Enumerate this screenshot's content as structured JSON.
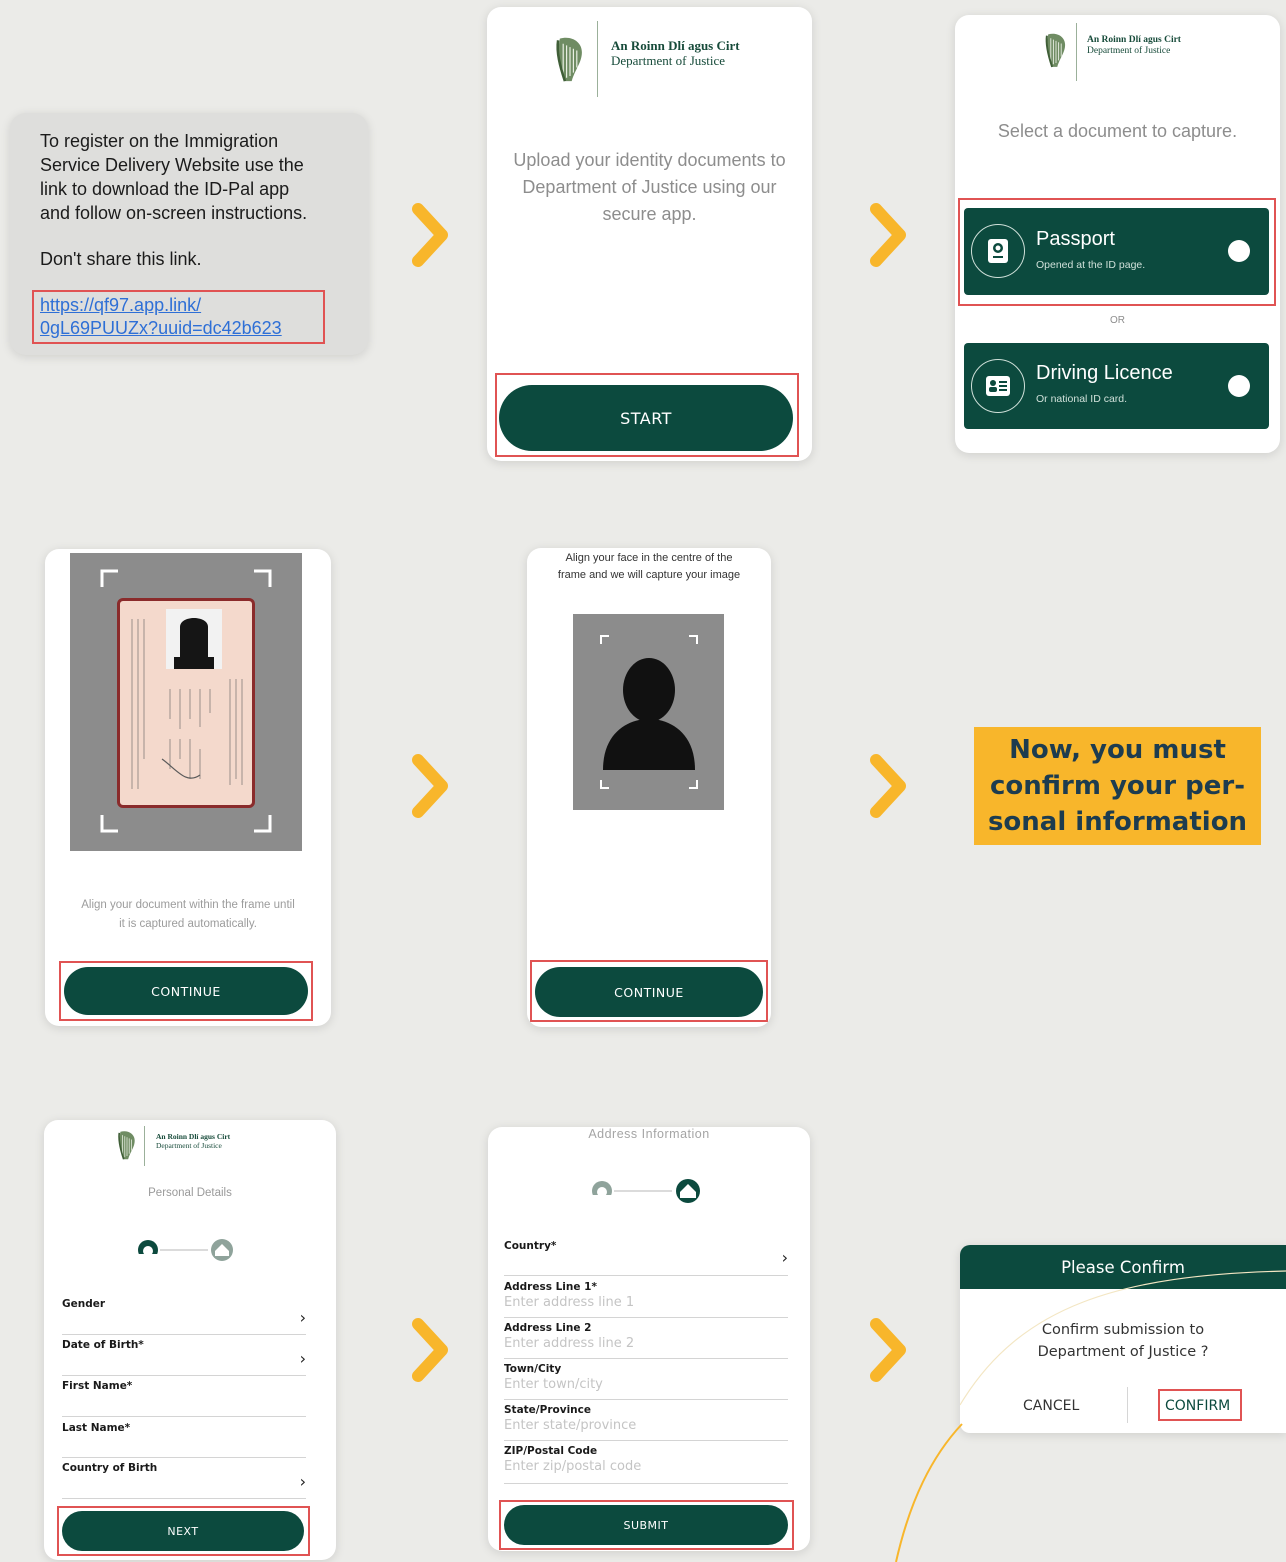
{
  "colors": {
    "background": "#ebebe8",
    "brand_green": "#0c4a3e",
    "accent_yellow": "#f8b62b",
    "highlight_red": "#e05353",
    "banner_text": "#1d3c4f"
  },
  "sms": {
    "message_lines": [
      "To register on the Immigration",
      "Service Delivery Website use the",
      "link to download the ID-Pal app",
      "and follow on-screen instructions."
    ],
    "warning": "Don't share this link.",
    "link_line1": "https://qf97.app.link/",
    "link_line2": "0gL69PUUZx?uuid=dc42b623"
  },
  "logo": {
    "irish": "An Roinn Dlí agus Cirt",
    "english": "Department of Justice"
  },
  "start_screen": {
    "message_lines": [
      "Upload your identity documents to",
      "Department of Justice  using our",
      "secure app."
    ],
    "start_label": "START"
  },
  "select_screen": {
    "title": "Select a document to capture.",
    "passport_title": "Passport",
    "passport_sub": "Opened at the ID page.",
    "or_label": "OR",
    "licence_title": "Driving Licence",
    "licence_sub": "Or national ID card."
  },
  "doc_capture": {
    "instruction_lines": [
      "Align your document within the frame until",
      "it is captured automatically."
    ],
    "continue_label": "CONTINUE"
  },
  "face_capture": {
    "instruction_lines": [
      "Align your face in the centre of the",
      "frame and we will capture your image"
    ],
    "continue_label": "CONTINUE"
  },
  "banner": {
    "lines": [
      "Now, you must",
      "confirm your per-",
      "sonal information"
    ]
  },
  "personal_details": {
    "title": "Personal Details",
    "fields": [
      "Gender",
      "Date of Birth*",
      "First Name*",
      "Last Name*",
      "Country of Birth"
    ],
    "next_label": "NEXT"
  },
  "address_info": {
    "title": "Address Information",
    "country_label": "Country*",
    "fields": [
      {
        "label": "Address Line 1*",
        "placeholder": "Enter address line 1"
      },
      {
        "label": "Address Line 2",
        "placeholder": "Enter address line 2"
      },
      {
        "label": "Town/City",
        "placeholder": "Enter town/city"
      },
      {
        "label": "State/Province",
        "placeholder": "Enter state/province"
      },
      {
        "label": "ZIP/Postal Code",
        "placeholder": "Enter zip/postal code"
      }
    ],
    "submit_label": "SUBMIT"
  },
  "confirm_dialog": {
    "title": "Please Confirm",
    "message_lines": [
      "Confirm submission to",
      "Department of Justice  ?"
    ],
    "cancel_label": "CANCEL",
    "confirm_label": "CONFIRM"
  }
}
